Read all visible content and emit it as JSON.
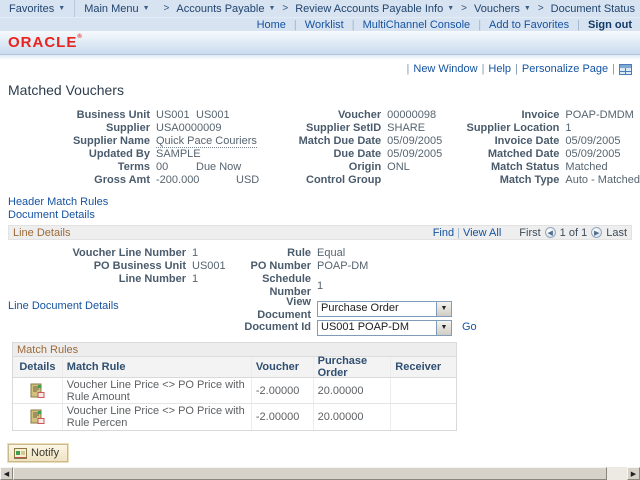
{
  "topnav": {
    "favorites_label": "Favorites",
    "main_menu_label": "Main Menu",
    "crumbs": [
      {
        "label": "Accounts Payable"
      },
      {
        "label": "Review Accounts Payable Info"
      },
      {
        "label": "Vouchers"
      },
      {
        "label": "Document Status"
      }
    ],
    "links": {
      "home": "Home",
      "worklist": "Worklist",
      "multichannel": "MultiChannel Console",
      "add_to_favorites": "Add to Favorites",
      "sign_out": "Sign out"
    }
  },
  "brand": {
    "logo_text": "ORACLE",
    "logo_color": "#e8231d"
  },
  "page_utils": {
    "new_window": "New Window",
    "help": "Help",
    "personalize_page": "Personalize Page"
  },
  "page_title": "Matched Vouchers",
  "voucher_header": {
    "col1": [
      {
        "label": "Business Unit",
        "value": "US001",
        "value2": "US001"
      },
      {
        "label": "Supplier",
        "value": "USA0000009",
        "value2": ""
      },
      {
        "label": "Supplier Name",
        "value": "Quick Pace Couriers",
        "value2": ""
      },
      {
        "label": "Updated By",
        "value": "SAMPLE",
        "value2": ""
      },
      {
        "label": "Terms",
        "value": "00",
        "value2": "Due Now"
      },
      {
        "label": "Gross Amt",
        "value": "-200.000",
        "value2": "USD"
      }
    ],
    "col2": [
      {
        "label": "Voucher",
        "value": "00000098"
      },
      {
        "label": "Supplier SetID",
        "value": "SHARE"
      },
      {
        "label": "Match Due Date",
        "value": "05/09/2005"
      },
      {
        "label": "Due Date",
        "value": "05/09/2005"
      },
      {
        "label": "Origin",
        "value": "ONL"
      },
      {
        "label": "Control Group",
        "value": ""
      }
    ],
    "col3": [
      {
        "label": "Invoice",
        "value": "POAP-DMDM"
      },
      {
        "label": "Supplier Location",
        "value": "1"
      },
      {
        "label": "Invoice Date",
        "value": "05/09/2005"
      },
      {
        "label": "Matched Date",
        "value": "05/09/2005"
      },
      {
        "label": "Match Status",
        "value": "Matched"
      },
      {
        "label": "Match Type",
        "value": "Auto - Matched"
      }
    ]
  },
  "links": {
    "header_match_rules": "Header Match Rules",
    "document_details": "Document Details",
    "line_document_details": "Line Document Details",
    "go": "Go"
  },
  "line_details": {
    "title": "Line Details",
    "find": "Find",
    "view_all": "View All",
    "first": "First",
    "page_info": "1 of 1",
    "last": "Last",
    "fields_left": [
      {
        "label": "Voucher Line Number",
        "value": "1"
      },
      {
        "label": "PO Business Unit",
        "value": "US001"
      },
      {
        "label": "Line Number",
        "value": "1"
      }
    ],
    "fields_right": [
      {
        "label": "Rule",
        "value": "Equal"
      },
      {
        "label": "PO Number",
        "value": "POAP-DM"
      },
      {
        "label": "Schedule Number",
        "value": "1"
      }
    ],
    "view_document": {
      "label": "View Document",
      "value": "Purchase Order"
    },
    "document_id": {
      "label": "Document Id",
      "value": "US001 POAP-DM"
    }
  },
  "match_rules": {
    "title": "Match Rules",
    "columns": [
      "Details",
      "Match Rule",
      "Voucher",
      "Purchase Order",
      "Receiver"
    ],
    "rows": [
      {
        "match_rule": "Voucher Line Price <> PO Price with Rule Amount",
        "voucher": "-2.00000",
        "purchase_order": "20.00000",
        "receiver": ""
      },
      {
        "match_rule": "Voucher Line Price <> PO Price with Rule Percen",
        "voucher": "-2.00000",
        "purchase_order": "20.00000",
        "receiver": ""
      }
    ]
  },
  "footer": {
    "notify": "Notify"
  }
}
